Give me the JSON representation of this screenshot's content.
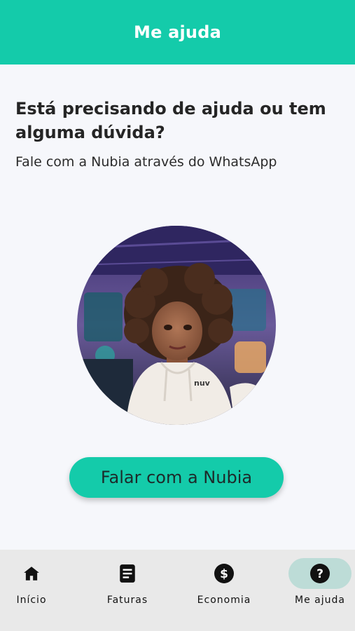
{
  "header": {
    "title": "Me ajuda"
  },
  "main": {
    "headline": "Está precisando de ajuda ou tem alguma dúvida?",
    "subline": "Fale com a Nubia através do WhatsApp",
    "avatar_badge": "nuv",
    "cta_label": "Falar com a Nubia"
  },
  "nav": {
    "items": [
      {
        "label": "Início",
        "icon": "home-icon"
      },
      {
        "label": "Faturas",
        "icon": "document-icon"
      },
      {
        "label": "Economia",
        "icon": "dollar-icon"
      },
      {
        "label": "Me ajuda",
        "icon": "help-icon",
        "active": true
      }
    ]
  },
  "colors": {
    "brand": "#14cbaa",
    "active_pill": "#bddcd7",
    "background": "#f6f7fb",
    "nav_background": "#e9e9e9"
  }
}
